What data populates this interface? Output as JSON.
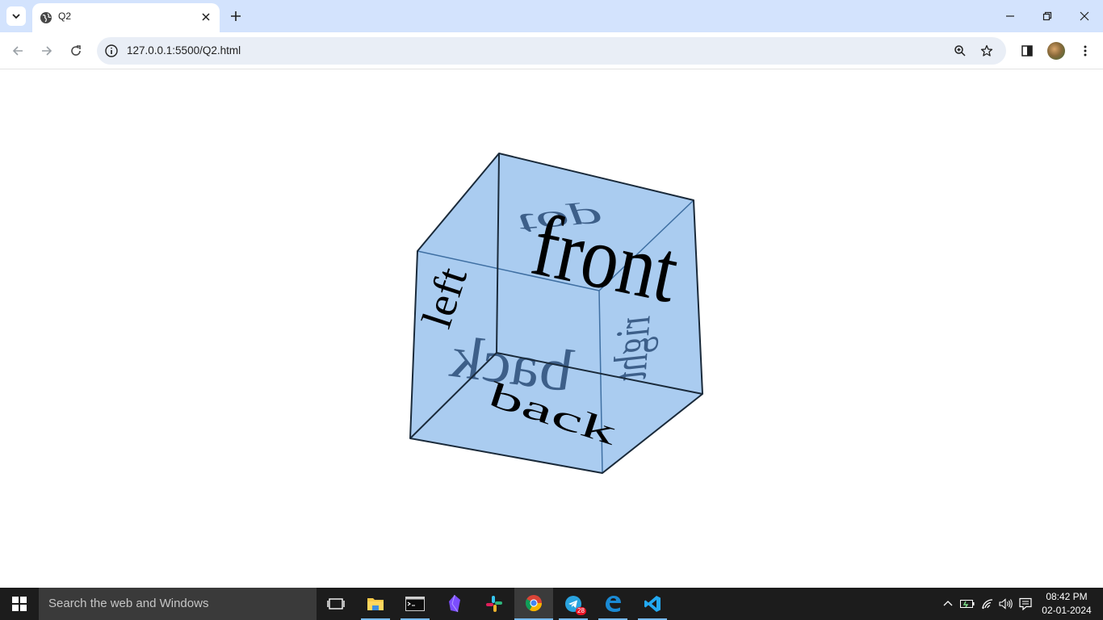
{
  "browser": {
    "tab_title": "Q2",
    "url": "127.0.0.1:5500/Q2.html"
  },
  "cube": {
    "faces": {
      "top": "top",
      "front": "front",
      "left": "left",
      "right": "right",
      "back": "back",
      "bottom": "back"
    },
    "colors": {
      "face_fill": "#6ea8e6",
      "edge": "#1a3a5c",
      "text": "#000000",
      "text_mirrored": "#2a4d78"
    }
  },
  "taskbar": {
    "search_placeholder": "Search the web and Windows",
    "apps": [
      "task-view",
      "file-explorer",
      "terminal",
      "obsidian",
      "slack",
      "chrome",
      "telegram",
      "edge",
      "vscode"
    ],
    "telegram_badge": "28",
    "time": "08:42 PM",
    "date": "02-01-2024"
  }
}
